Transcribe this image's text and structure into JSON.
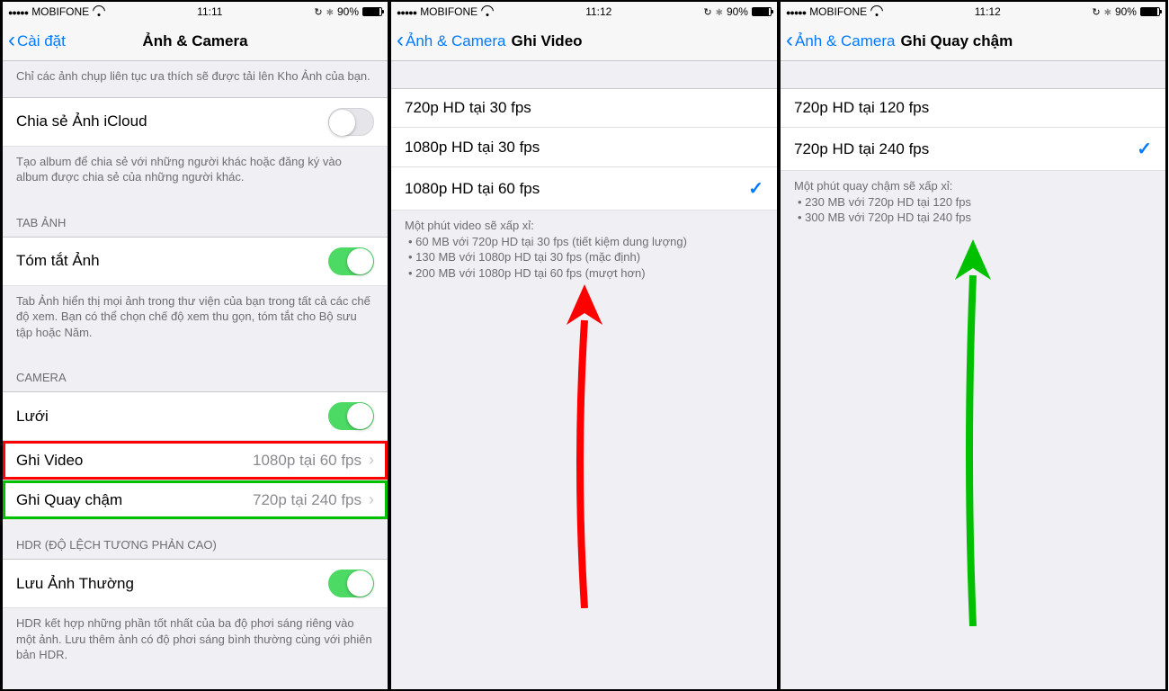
{
  "status": {
    "carrier": "MOBIFONE",
    "time1": "11:11",
    "time2": "11:12",
    "time3": "11:12",
    "battery": "90%"
  },
  "screen1": {
    "back": "Cài đặt",
    "title": "Ảnh & Camera",
    "topFooter": "Chỉ các ảnh chụp liên tục ưa thích sẽ được tải lên Kho Ảnh của bạn.",
    "icloudShare": "Chia sẻ Ảnh iCloud",
    "icloudFooter": "Tạo album để chia sẻ với những người khác hoặc đăng ký vào album được chia sẻ của những người khác.",
    "tabHeader": "TAB ẢNH",
    "summarize": "Tóm tắt Ảnh",
    "tabFooter": "Tab Ảnh hiển thị mọi ảnh trong thư viện của bạn trong tất cả các chế độ xem. Bạn có thể chọn chế độ xem thu gọn, tóm tắt cho Bộ sưu tập hoặc Năm.",
    "cameraHeader": "CAMERA",
    "grid": "Lưới",
    "recVideo": "Ghi Video",
    "recVideoVal": "1080p tại 60 fps",
    "recSlomo": "Ghi Quay chậm",
    "recSlomoVal": "720p tại 240 fps",
    "hdrHeader": "HDR (ĐỘ LỆCH TƯƠNG PHẢN CAO)",
    "keepNormal": "Lưu Ảnh Thường",
    "hdrFooter": "HDR kết hợp những phần tốt nhất của ba độ phơi sáng riêng vào một ảnh. Lưu thêm ảnh có độ phơi sáng bình thường cùng với phiên bản HDR."
  },
  "screen2": {
    "back": "Ảnh & Camera",
    "title": "Ghi Video",
    "opt1": "720p HD tại 30 fps",
    "opt2": "1080p HD tại 30 fps",
    "opt3": "1080p HD tại 60 fps",
    "footerLead": "Một phút video sẽ xấp xỉ:",
    "footer1": "60 MB với 720p HD tại 30 fps (tiết kiệm dung lượng)",
    "footer2": "130 MB với 1080p HD tại 30 fps (mặc định)",
    "footer3": "200 MB với 1080p HD tại 60 fps (mượt hơn)"
  },
  "screen3": {
    "back": "Ảnh & Camera",
    "title": "Ghi Quay chậm",
    "opt1": "720p HD tại 120 fps",
    "opt2": "720p HD tại 240 fps",
    "footerLead": "Một phút quay chậm sẽ xấp xỉ:",
    "footer1": "230 MB với 720p HD tại 120 fps",
    "footer2": "300 MB với 720p HD tại 240 fps"
  }
}
